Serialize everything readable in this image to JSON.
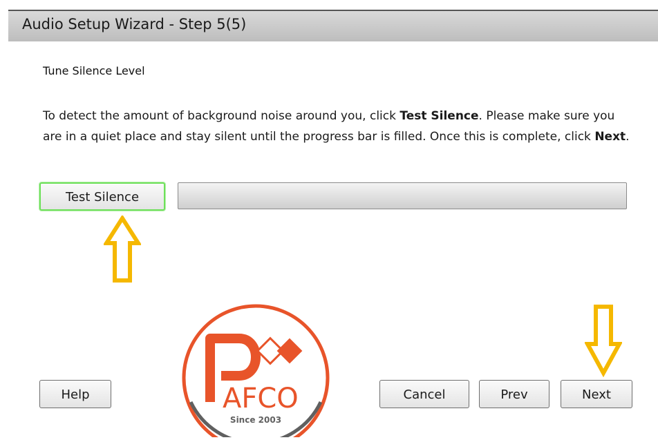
{
  "window": {
    "title": "Audio Setup Wizard - Step 5(5)"
  },
  "content": {
    "heading": "Tune Silence Level",
    "instruction_part1": "To detect the amount of background noise around you, click ",
    "instruction_bold1": "Test Silence",
    "instruction_part2": ". Please make sure you are in a quiet place and stay silent until the progress bar is filled. Once this is complete, click ",
    "instruction_bold2": "Next",
    "instruction_part3": "."
  },
  "controls": {
    "test_silence_label": "Test Silence",
    "progress_percent": 0
  },
  "footer": {
    "help_label": "Help",
    "cancel_label": "Cancel",
    "prev_label": "Prev",
    "next_label": "Next"
  },
  "annotations": {
    "arrow_color": "#f5b800",
    "arrow_up_icon": "arrow-up-outline-icon",
    "arrow_down_icon": "arrow-down-outline-icon"
  },
  "watermark": {
    "brand_letters": "AFCO",
    "since_text": "Since 2003",
    "brand_color": "#e8542a",
    "ring_color": "#606060"
  },
  "colors": {
    "titlebar": "#c8c8c8",
    "focus_border": "#6ee05a",
    "progress_track": "#d9d9d9"
  }
}
